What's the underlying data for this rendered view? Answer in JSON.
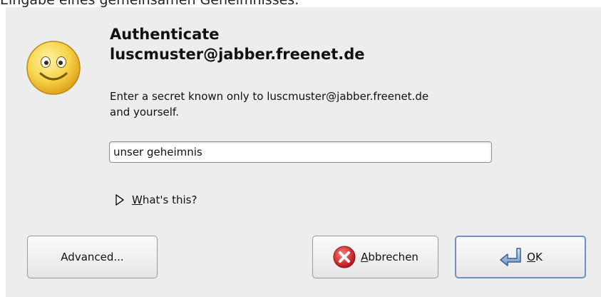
{
  "caption": "Eingabe eines gemeinsamen Geheimnisses:",
  "dialog": {
    "title_line1": "Authenticate",
    "title_line2": "luscmuster@jabber.freenet.de",
    "message_line1": "Enter a secret known only to luscmuster@jabber.freenet.de",
    "message_line2": "and yourself.",
    "secret_value": "unser geheimnis",
    "expander": {
      "mnemonic": "W",
      "rest": "hat's this?"
    },
    "buttons": {
      "advanced": "Advanced...",
      "cancel_mnemonic": "A",
      "cancel_rest": "bbrechen",
      "ok_mnemonic": "O",
      "ok_rest": "K"
    }
  },
  "colors": {
    "dialog_bg": "#ededed",
    "smiley_yellow": "#f7d44a",
    "cancel_red": "#d8262b",
    "ok_blue": "#6f8fc0"
  },
  "icons": {
    "smiley": "smiley-face-icon",
    "expander": "expander-triangle-icon",
    "cancel": "cancel-x-icon",
    "ok": "ok-return-arrow-icon"
  }
}
